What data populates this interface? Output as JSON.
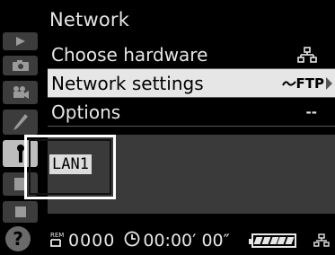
{
  "title": "Network",
  "menu": {
    "items": [
      {
        "label": "Choose hardware",
        "value_icon": "network-icon",
        "value": ""
      },
      {
        "label": "Network settings",
        "value": "FTP",
        "value_icon": "ftp-wave-icon"
      },
      {
        "label": "Options",
        "value": "--"
      }
    ]
  },
  "panel": {
    "connection": "LAN1"
  },
  "status": {
    "rem_label": "REM",
    "count": "0000",
    "timecode": "00:00′ 00″",
    "battery_level": 1.0
  },
  "colors": {
    "highlight": "#e6e6e6",
    "panel": "#3a3a3a"
  }
}
